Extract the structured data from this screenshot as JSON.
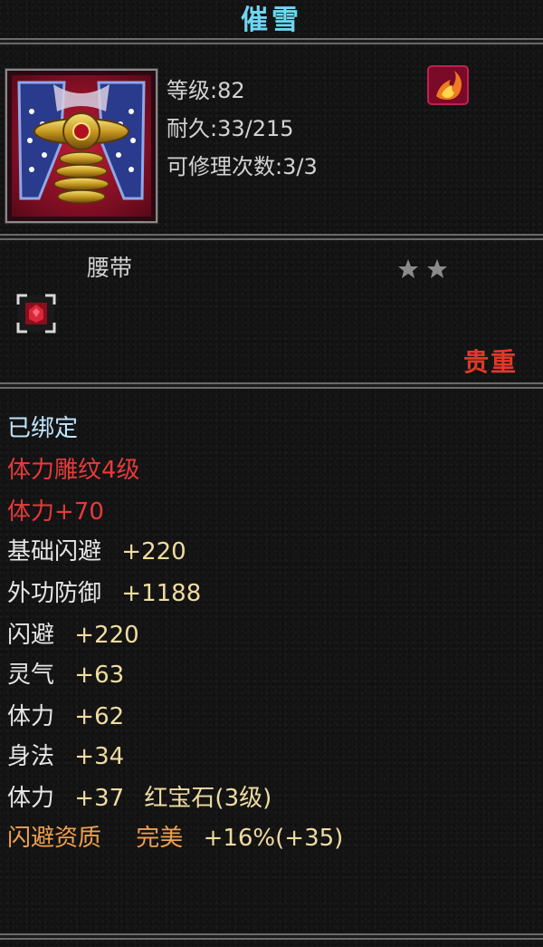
{
  "item": {
    "name": "催雪",
    "name_color": "#6fd6f2",
    "icon": "belt-item-icon",
    "class_icon": "fire-emblem-icon",
    "level_line": "等级:82",
    "durability_line": "耐久:33/215",
    "repair_line": "可修理次数:3/3",
    "type": "腰带",
    "stars": 2,
    "socket_icon": "red-gem-socket-icon",
    "quality": "贵重",
    "quality_color": "#e03a28"
  },
  "stats": {
    "bound": "已绑定",
    "engrave": "体力雕纹4级",
    "engrave_bonus": "体力+70",
    "base_dodge_label": "基础闪避",
    "base_dodge_value": "+220",
    "ext_def_label": "外功防御",
    "ext_def_value": "+1188",
    "dodge_label": "闪避",
    "dodge_value": "+220",
    "spirit_label": "灵气",
    "spirit_value": "+63",
    "stamina_label": "体力",
    "stamina_value": "+62",
    "agility_label": "身法",
    "agility_value": "+34",
    "gem_stat_label": "体力",
    "gem_stat_value": "+37",
    "gem_name": "红宝石(3级)",
    "aptitude_label": "闪避资质",
    "aptitude_grade": "完美",
    "aptitude_value": "+16%(+35)"
  }
}
